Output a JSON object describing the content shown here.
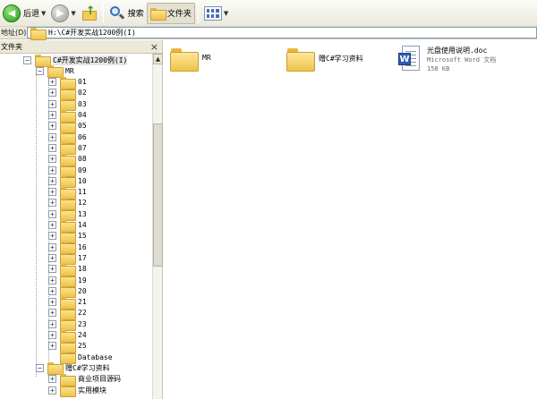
{
  "toolbar": {
    "back_label": "后退",
    "search_label": "搜索",
    "folders_label": "文件夹"
  },
  "address": {
    "label": "地址(D)",
    "path": "H:\\C#开发实战1200例(I)"
  },
  "folder_pane": {
    "title": "文件夹",
    "close": "×",
    "tree": [
      {
        "label": "C#开发实战1200例(I)",
        "expander": "−",
        "selected": true
      },
      {
        "label": "MR",
        "expander": "−"
      },
      {
        "label": "01",
        "expander": "+"
      },
      {
        "label": "02",
        "expander": "+"
      },
      {
        "label": "03",
        "expander": "+"
      },
      {
        "label": "04",
        "expander": "+"
      },
      {
        "label": "05",
        "expander": "+"
      },
      {
        "label": "06",
        "expander": "+"
      },
      {
        "label": "07",
        "expander": "+"
      },
      {
        "label": "08",
        "expander": "+"
      },
      {
        "label": "09",
        "expander": "+"
      },
      {
        "label": "10",
        "expander": "+"
      },
      {
        "label": "11",
        "expander": "+"
      },
      {
        "label": "12",
        "expander": "+"
      },
      {
        "label": "13",
        "expander": "+"
      },
      {
        "label": "14",
        "expander": "+"
      },
      {
        "label": "15",
        "expander": "+"
      },
      {
        "label": "16",
        "expander": "+"
      },
      {
        "label": "17",
        "expander": "+"
      },
      {
        "label": "18",
        "expander": "+"
      },
      {
        "label": "19",
        "expander": "+"
      },
      {
        "label": "20",
        "expander": "+"
      },
      {
        "label": "21",
        "expander": "+"
      },
      {
        "label": "22",
        "expander": "+"
      },
      {
        "label": "23",
        "expander": "+"
      },
      {
        "label": "24",
        "expander": "+"
      },
      {
        "label": "25",
        "expander": "+"
      },
      {
        "label": "Database",
        "expander": ""
      },
      {
        "label": "赠C#学习资料",
        "expander": "−"
      },
      {
        "label": "商业项目源码",
        "expander": "+"
      },
      {
        "label": "实用模块",
        "expander": "+"
      }
    ]
  },
  "content": {
    "items": [
      {
        "type": "folder",
        "name": "MR"
      },
      {
        "type": "folder",
        "name": "赠C#学习资料"
      },
      {
        "type": "document",
        "name": "光盘使用说明.doc",
        "kind": "Microsoft Word 文档",
        "size": "158 KB"
      }
    ]
  },
  "icons": {
    "back": "back-arrow-icon",
    "forward": "forward-arrow-icon",
    "up": "folder-up-icon",
    "search": "search-icon",
    "folders": "folder-icon",
    "views": "views-icon",
    "word": "word-document-icon"
  },
  "colors": {
    "toolbar_bg": "#ece9d8",
    "folder_yellow": "#f0c34b",
    "word_blue": "#2b5eb3",
    "back_green": "#2c9a1a"
  }
}
